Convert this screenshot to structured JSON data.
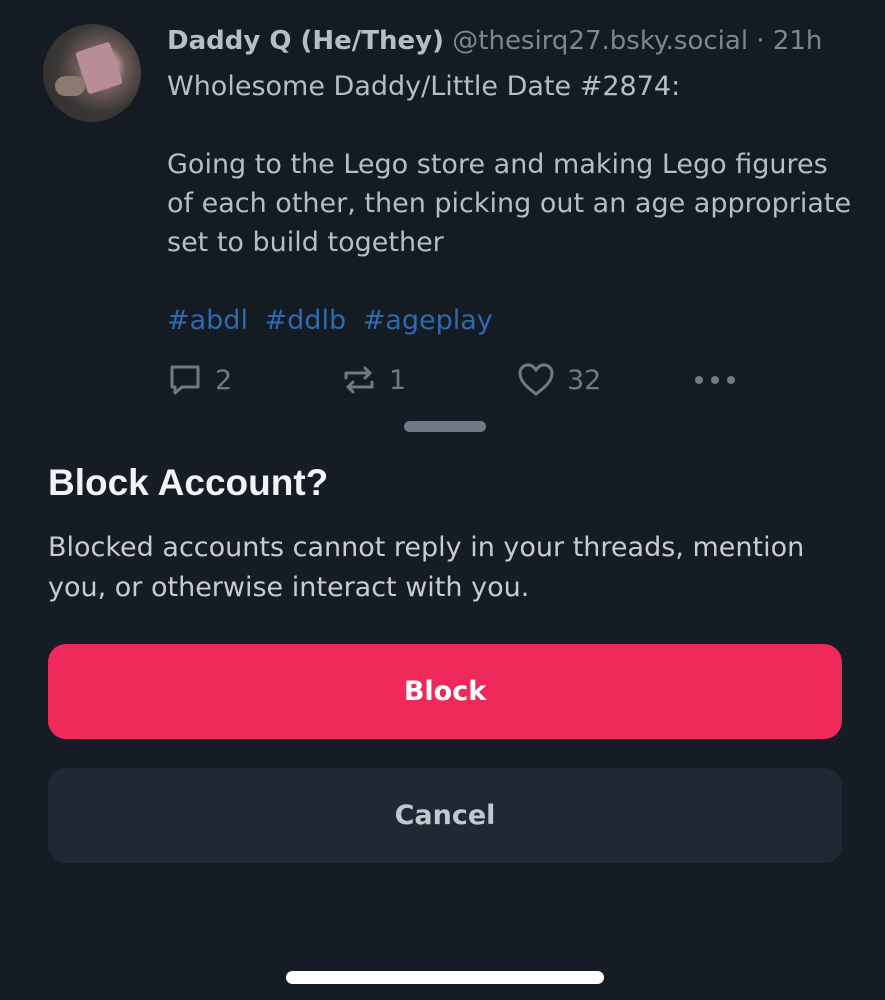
{
  "post": {
    "author_name": "Daddy Q (He/They)",
    "author_handle": "@thesirq27.bsky.social",
    "separator": "·",
    "timestamp": "21h",
    "text_line1": "Wholesome Daddy/Little Date #2874:",
    "text_line2": "Going to the Lego store and making Lego figures of each other, then picking out an age appropriate set to build together",
    "hashtags": [
      "#abdl",
      "#ddlb",
      "#ageplay"
    ],
    "reply_count": "2",
    "repost_count": "1",
    "like_count": "32"
  },
  "sheet": {
    "title": "Block Account?",
    "description": "Blocked accounts cannot reply in your threads, mention you, or otherwise interact with you.",
    "block_label": "Block",
    "cancel_label": "Cancel"
  },
  "colors": {
    "block_button": "#f0295b",
    "hashtag": "#2f6ab0",
    "sheet_bg": "#161c24"
  }
}
